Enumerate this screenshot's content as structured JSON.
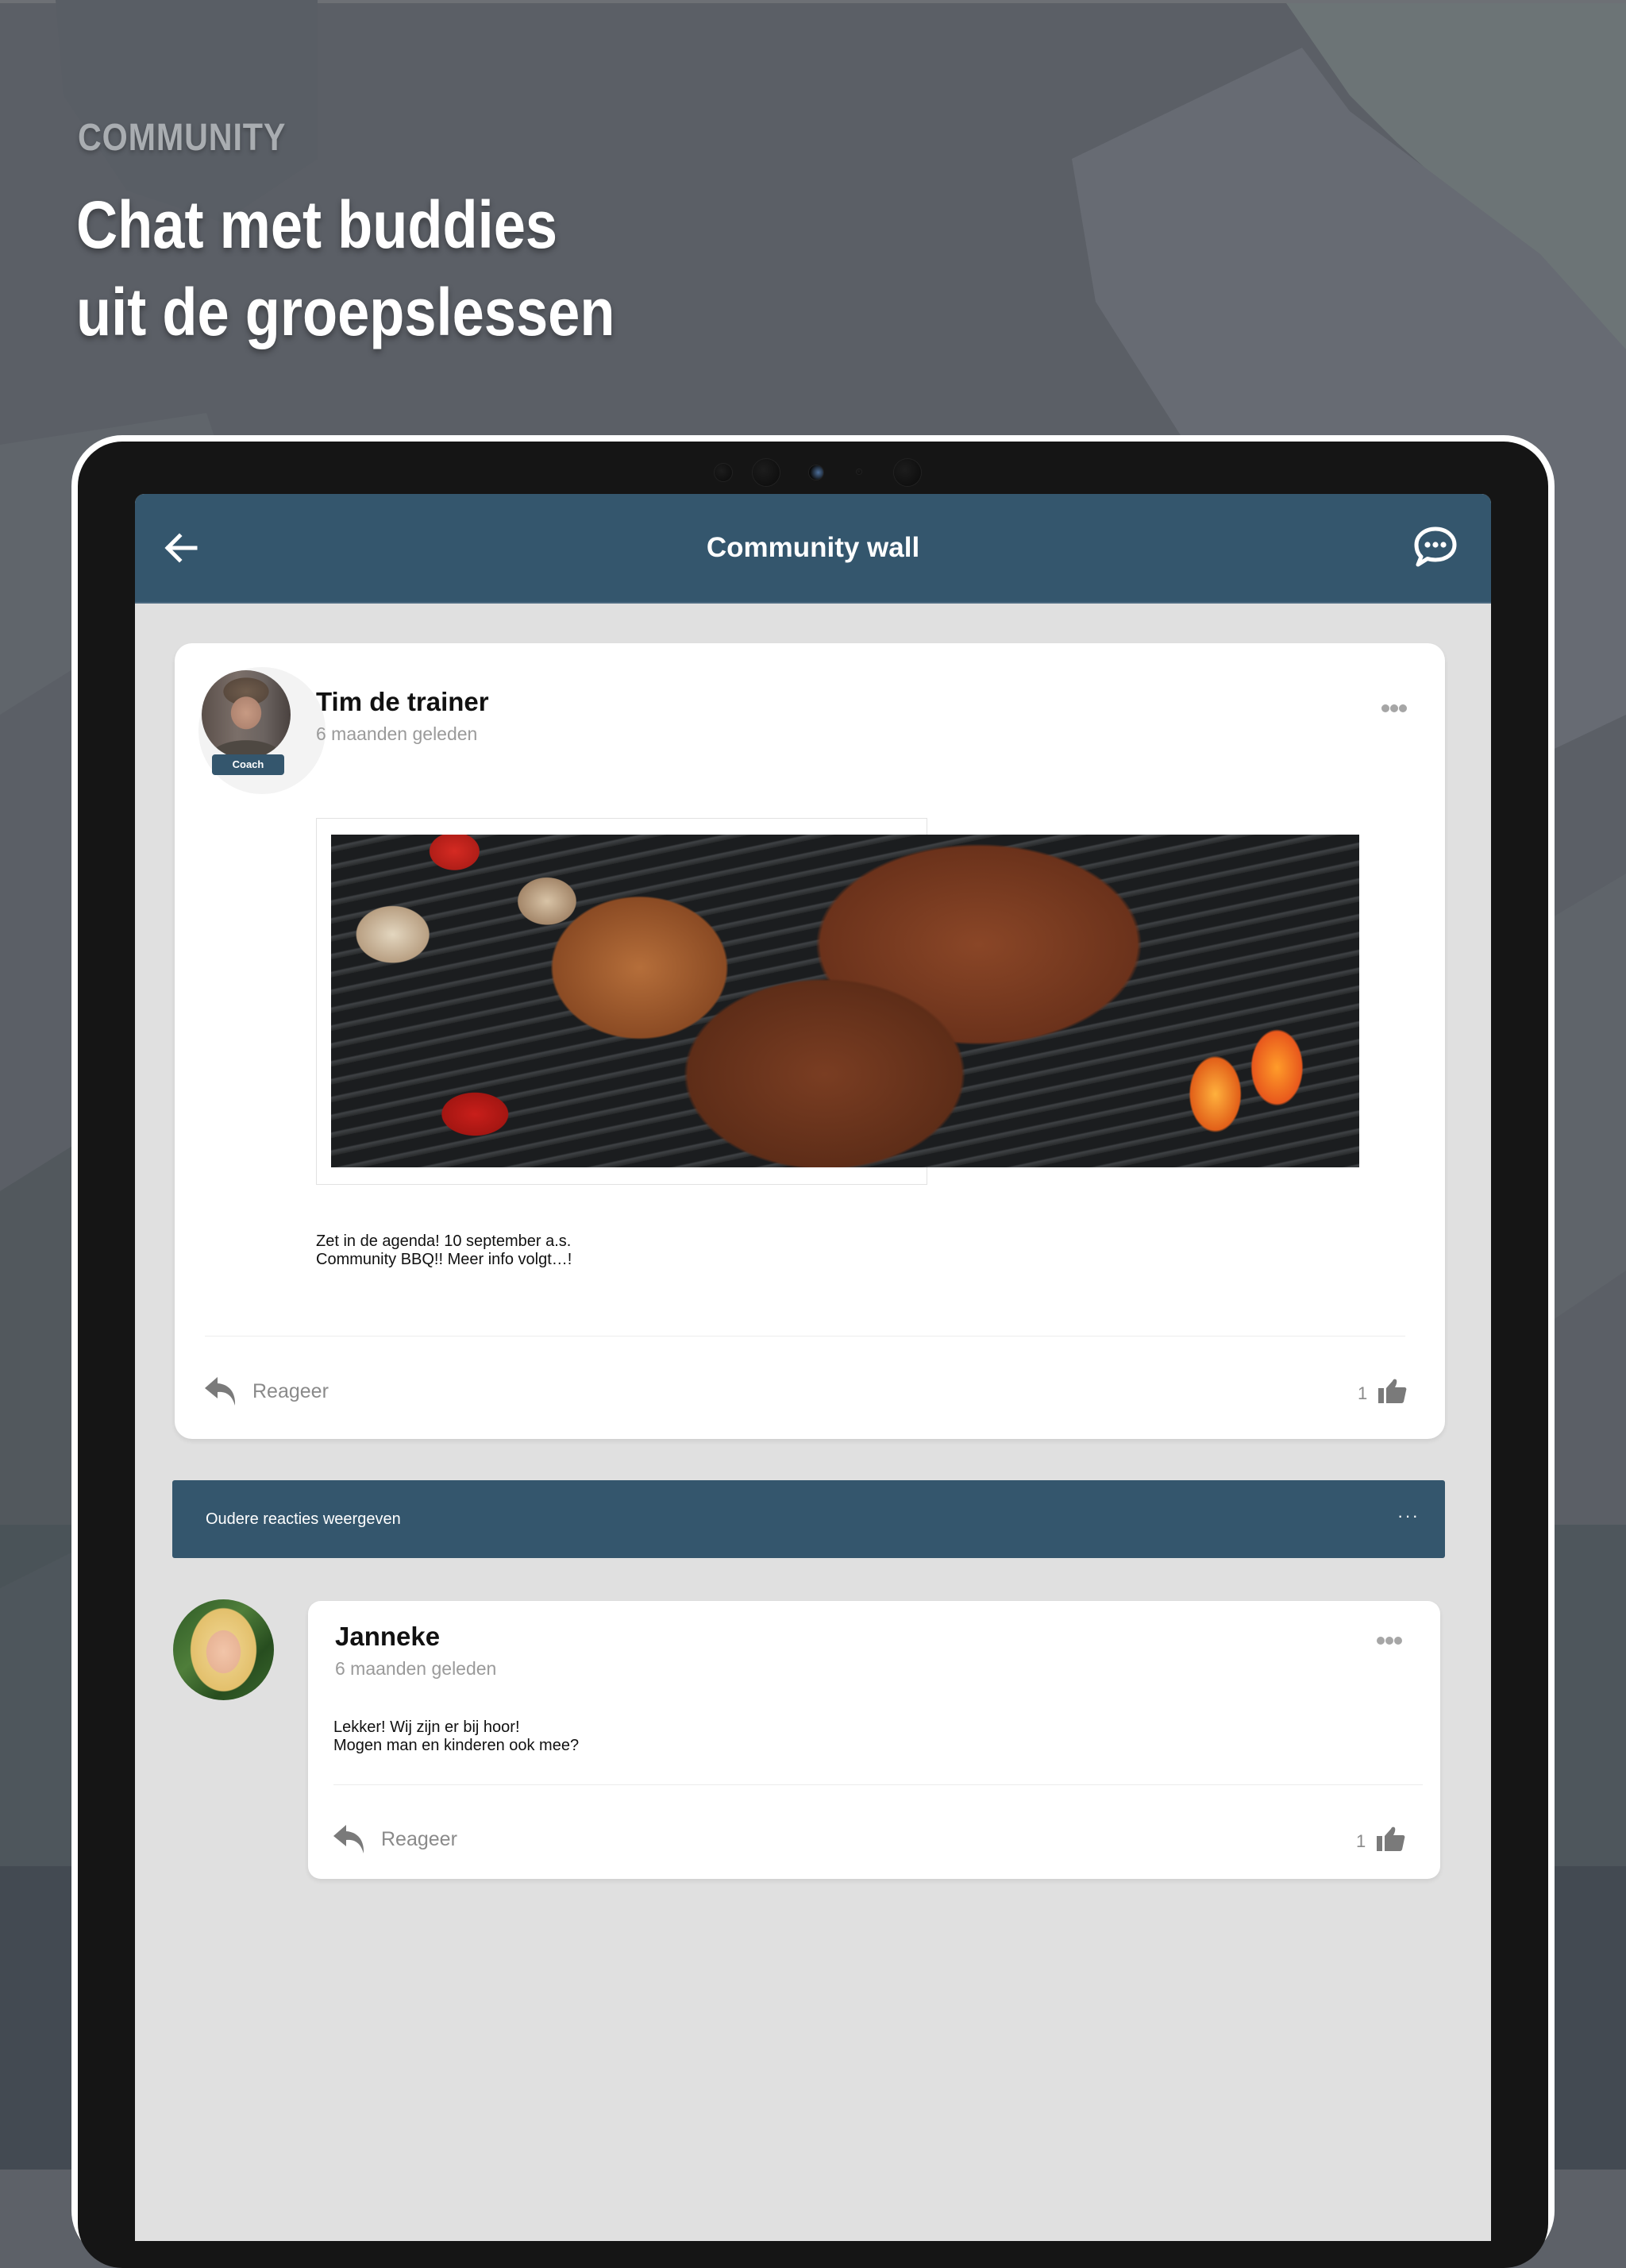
{
  "promo": {
    "kicker": "COMMUNITY",
    "title_line1": "Chat met buddies",
    "title_line2": "uit de groepslessen"
  },
  "header": {
    "title": "Community wall",
    "back_icon": "arrow-left-icon",
    "chat_icon": "chat-bubble-dots-icon"
  },
  "post": {
    "author": "Tim de trainer",
    "role_badge": "Coach",
    "time": "6 maanden geleden",
    "image_alt": "Barbecue grill met vlees en groenten",
    "body_line1": "Zet in de agenda! 10 september a.s.",
    "body_line2": "Community BBQ!! Meer info volgt…!",
    "reply_label": "Reageer",
    "like_count": "1"
  },
  "older_comments": {
    "label": "Oudere reacties weergeven",
    "more": "···"
  },
  "comments": [
    {
      "author": "Janneke",
      "time": "6 maanden geleden",
      "body_line1": "Lekker! Wij zijn er bij hoor!",
      "body_line2": "Mogen man en kinderen ook mee?",
      "reply_label": "Reageer",
      "like_count": "1"
    }
  ],
  "colors": {
    "brand": "#34566d",
    "screen_bg": "#e0e0e0",
    "muted_text": "#9a9a9a",
    "icon_grey": "#7a7a7a"
  }
}
